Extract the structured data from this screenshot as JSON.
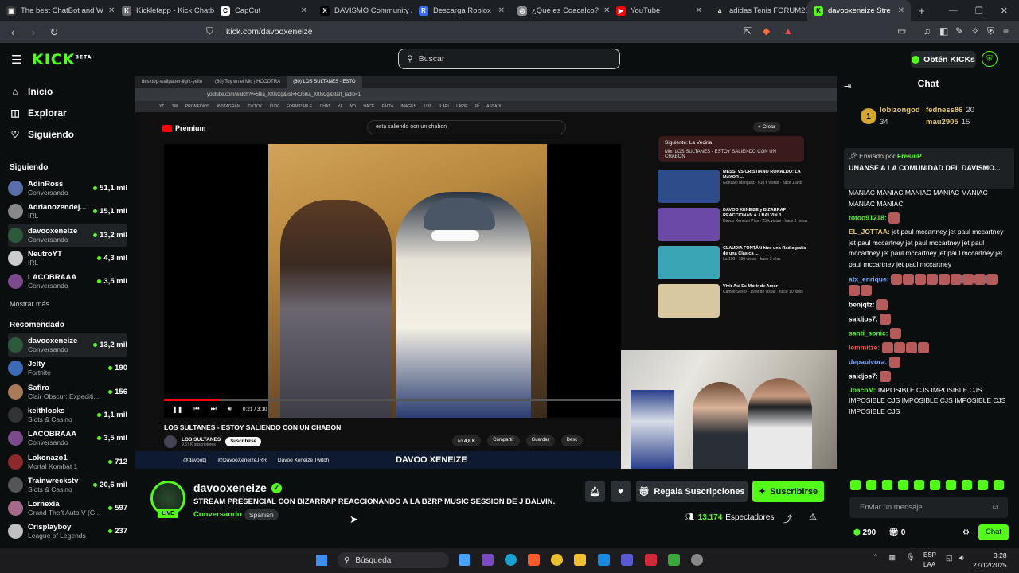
{
  "browser": {
    "tabs": [
      {
        "label": "The best ChatBot and W",
        "color": "#3a3a3a",
        "glyph": "▣"
      },
      {
        "label": "Kickletapp - Kick Chatbo",
        "color": "#6b6b6b",
        "glyph": "K"
      },
      {
        "label": "CapCut",
        "color": "#ffffff",
        "glyph": "C"
      },
      {
        "label": "DAVISMO Community / X",
        "color": "#000000",
        "glyph": "X"
      },
      {
        "label": "Descarga Roblox",
        "color": "#3b6cf0",
        "glyph": "R"
      },
      {
        "label": "¿Qué es Coacalco?",
        "color": "#888888",
        "glyph": "◎"
      },
      {
        "label": "YouTube",
        "color": "#ff0000",
        "glyph": "▶"
      },
      {
        "label": "adidas Tenis FORUM2000",
        "color": "#222222",
        "glyph": "a"
      },
      {
        "label": "davooxeneize Stre",
        "color": "#53fc18",
        "glyph": "K",
        "active": true
      }
    ],
    "new_tab": "+",
    "url": "kick.com/davooxeneize"
  },
  "kick": {
    "logo": "KICK",
    "logo_badge": "BETA",
    "search_placeholder": "Buscar",
    "get_kicks": "Obtén KICKs"
  },
  "sidebar": {
    "nav": [
      {
        "label": "Inicio",
        "icon": "home-icon",
        "glyph": "⌂"
      },
      {
        "label": "Explorar",
        "icon": "compass-icon",
        "glyph": "◫"
      },
      {
        "label": "Siguiendo",
        "icon": "heart-icon",
        "glyph": "♡"
      }
    ],
    "following_title": "Siguiendo",
    "following": [
      {
        "name": "AdinRoss",
        "sub": "Conversando",
        "viewers": "51,1 mil",
        "color": "#5a6ea8"
      },
      {
        "name": "Adrianozendej...",
        "sub": "IRL",
        "viewers": "15,1 mil",
        "color": "#888888"
      },
      {
        "name": "davooxeneize",
        "sub": "Conversando",
        "viewers": "13,2 mil",
        "color": "#2d5a3c",
        "selected": true
      },
      {
        "name": "NeutroYT",
        "sub": "IRL",
        "viewers": "4,3 mil",
        "color": "#cccccc"
      },
      {
        "name": "LACOBRAAA",
        "sub": "Conversando",
        "viewers": "3,5 mil",
        "color": "#7a4a8a"
      }
    ],
    "show_more": "Mostrar más",
    "recommended_title": "Recomendado",
    "recommended": [
      {
        "name": "davooxeneize",
        "sub": "Conversando",
        "viewers": "13,2 mil",
        "color": "#2d5a3c",
        "selected": true
      },
      {
        "name": "Jelty",
        "sub": "Fortnite",
        "viewers": "190",
        "color": "#3d6ab5"
      },
      {
        "name": "Safiro",
        "sub": "Clair Obscur: Expediti...",
        "viewers": "156",
        "color": "#a87a5a"
      },
      {
        "name": "keithlocks",
        "sub": "Slots & Casino",
        "viewers": "1,1 mil",
        "color": "#333333"
      },
      {
        "name": "LACOBRAAA",
        "sub": "Conversando",
        "viewers": "3,5 mil",
        "color": "#7a4a8a"
      },
      {
        "name": "Lokonazo1",
        "sub": "Mortal Kombat 1",
        "viewers": "712",
        "color": "#8a2a2a"
      },
      {
        "name": "Trainwreckstv",
        "sub": "Slots & Casino",
        "viewers": "20,6 mil",
        "color": "#555555"
      },
      {
        "name": "Lornexia",
        "sub": "Grand Theft Auto V (G...",
        "viewers": "597",
        "color": "#a56a8a"
      },
      {
        "name": "Crisplayboy",
        "sub": "League of Legends",
        "viewers": "237",
        "color": "#c0c0c0"
      }
    ]
  },
  "video": {
    "inner_tabs": [
      "desktop-wallpaper-light-yello",
      "(60) Toy en el Mic | HOODTRA",
      "(60) LOS SULTANES - ESTO"
    ],
    "inner_url": "youtube.com/watch?v=5Ika_Xf0sCg&list=RD5Ika_Xf0sCg&start_radio=1",
    "bookmarks": "YT TW PROMEDIOS INSTAGRAM TIKTOK KICK FORMIDABLE CHAT YA NO HACE FALTA IMAGEN LUZ ILARI LARIE IR ASSADI",
    "yt_brand": "Premium",
    "yt_search": "esta saliendo ocn un chabon",
    "create": "+ Crear",
    "time": "0:21 / 3:10",
    "title": "LOS SULTANES - ESTOY SALIENDO CON UN CHABON",
    "channel": "LOS SULTANES",
    "subs": "9,67 K suscriptores",
    "subscribe": "Suscribirse",
    "likes": "4,8 K",
    "share": "Compartir",
    "save": "Guardar",
    "download": "Desc",
    "up_next_title": "Siguiente: La Vecina",
    "up_next_sub": "Mix: LOS SULTANES - ESTOY SALIENDO CON UN CHABON",
    "related": [
      {
        "title": "MESSI VS CRISTIANO RONALDO: LA MAYOR ...",
        "meta": "Gonzalo Marquez · 618 k vistas · hace 1 año",
        "color": "#2e4b8a"
      },
      {
        "title": "DAVOO XENEIZE y BIZARRAP REACCIONAN A J BALVIN // ...",
        "meta": "Davoo Xeneize Plus · 25 k vistas · hace 2 horas",
        "color": "#6a4aa5"
      },
      {
        "title": "CLAUDIA FONTÁN hizo una Radiografía de una Clásica ...",
        "meta": "La 100 · 199 vistas · hace 2 días",
        "color": "#3aa5b5"
      },
      {
        "title": "Vivir Asi Es Morir de Amor",
        "meta": "Camilo Sesto · 19 M de vistas · hace 10 años",
        "color": "#d8c8a0"
      }
    ],
    "banner_ig": "@davoobj",
    "banner_tw": "@DavooXeneizeJRR",
    "banner_twitch": "Davoo Xeneize Twitch",
    "banner_name": "DAVOO XENEIZE"
  },
  "stream": {
    "name": "davooxeneize",
    "title": "STREAM PRESENCIAL CON BIZARRAP REACCIONANDO A LA BZRP MUSIC SESSION DE J BALVIN.",
    "category": "Conversando",
    "language": "Spanish",
    "live": "LIVE",
    "gift": "Regala Suscripciones",
    "subscribe": "Suscribirse",
    "viewers": "13.174",
    "viewers_label": "Espectadores"
  },
  "chat": {
    "title": "Chat",
    "leaders": [
      {
        "name": "lobizongod",
        "value": "34"
      },
      {
        "name": "fedness86",
        "value": "20"
      },
      {
        "name": "mau2905",
        "value": "15"
      }
    ],
    "pinned_by_label": "Enviado por",
    "pinned_by": "FresiiiP",
    "pinned_msg": "UNANSE A LA COMUNIDAD DEL DAVISMO...",
    "messages": [
      {
        "user": "",
        "color": "#ffffff",
        "text": "MANIAC MANIAC MANIAC MANIAC MANIAC MANIAC MANIAC",
        "emotes": 0
      },
      {
        "user": "totoo91218:",
        "color": "#53fc18",
        "text": "",
        "emotes": 1
      },
      {
        "user": "EL_JOTTAA:",
        "color": "#e3c66a",
        "text": "jet paul mccartney jet paul mccartney jet paul mccartney jet paul mccartney jet paul mccartney jet paul mccartney jet paul mccartney jet paul mccartney jet paul mccartney",
        "emotes": 0
      },
      {
        "user": "atx_enrique:",
        "color": "#7aa7ff",
        "text": "",
        "emotes": 11
      },
      {
        "user": "benjqtz:",
        "color": "#ffffff",
        "text": "",
        "emotes": 1
      },
      {
        "user": "saidjos7:",
        "color": "#ffffff",
        "text": "",
        "emotes": 1
      },
      {
        "user": "santi_sonic:",
        "color": "#53fc18",
        "text": "",
        "emotes": 1
      },
      {
        "user": "lemmitze:",
        "color": "#ff5a5a",
        "text": "",
        "emotes": 4
      },
      {
        "user": "depaulvora:",
        "color": "#7aa7ff",
        "text": "",
        "emotes": 1
      },
      {
        "user": "saidjos7:",
        "color": "#ffffff",
        "text": "",
        "emotes": 1
      },
      {
        "user": "JoacoM:",
        "color": "#53fc18",
        "text": "IMPOSIBLE CJS IMPOSIBLE CJS IMPOSIBLE CJS IMPOSIBLE CJS IMPOSIBLE CJS IMPOSIBLE CJS",
        "emotes": 0
      }
    ],
    "input_placeholder": "Enviar un mensaje",
    "points": "290",
    "gifts": "0",
    "send": "Chat"
  },
  "taskbar": {
    "search": "Búsqueda",
    "lang1": "ESP",
    "lang2": "LAA",
    "time": "3:28",
    "date": "27/12/2025"
  }
}
